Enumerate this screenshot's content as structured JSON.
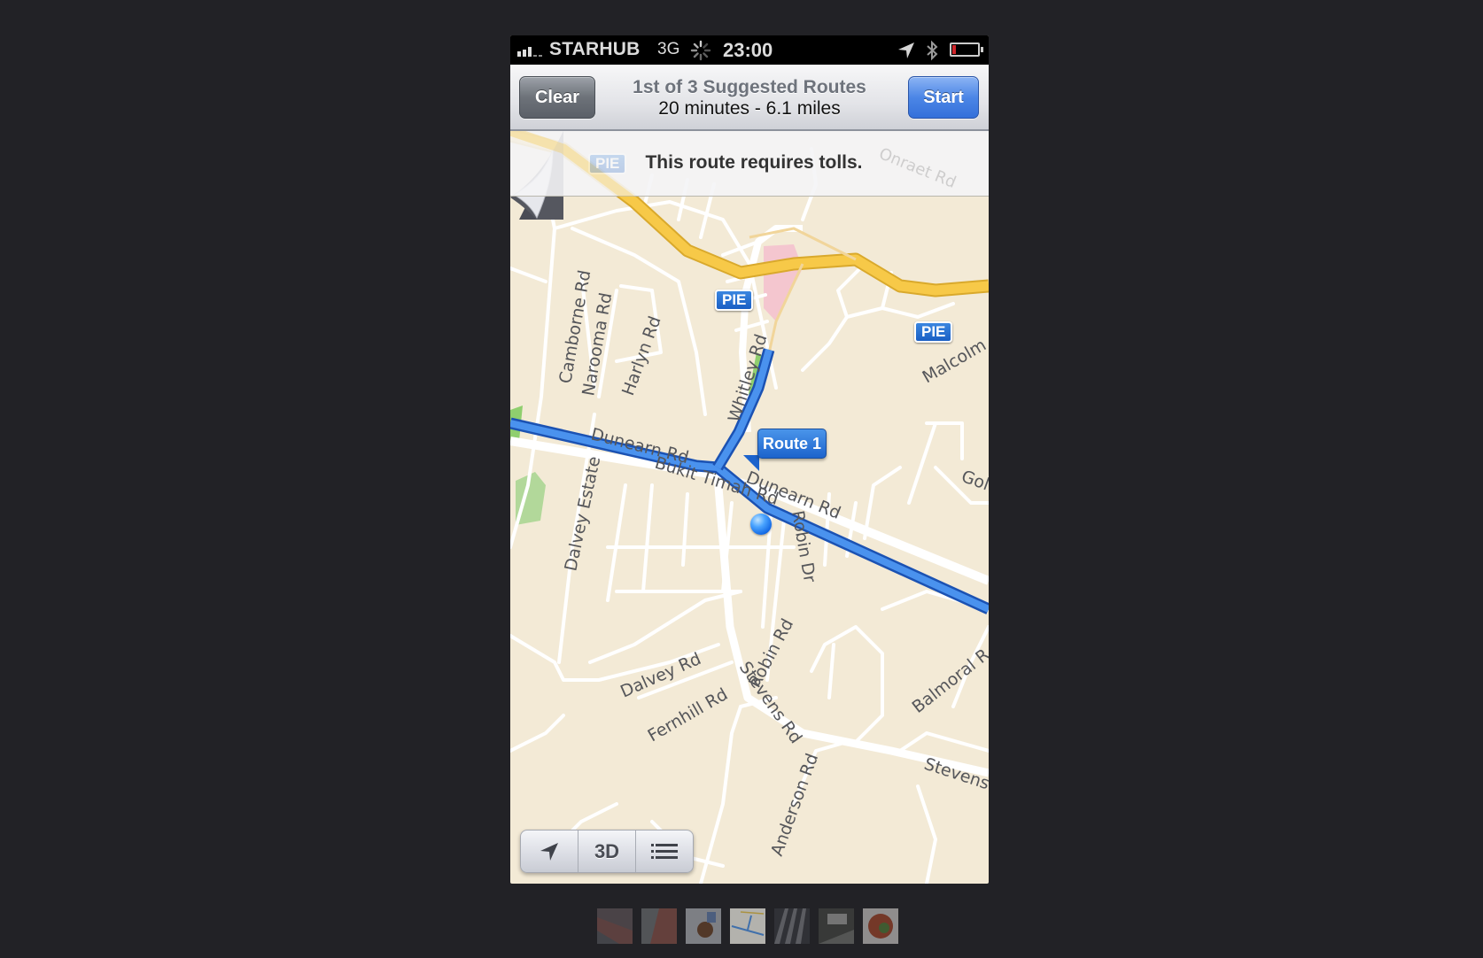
{
  "status_bar": {
    "carrier": "STARHUB",
    "network": "3G",
    "time": "23:00",
    "signal_bars": 3,
    "battery_level": 0.1,
    "icons": [
      "signal-icon",
      "activity-spinner-icon",
      "location-arrow-icon",
      "bluetooth-icon",
      "battery-icon"
    ]
  },
  "nav": {
    "clear_label": "Clear",
    "start_label": "Start",
    "title": "1st of 3 Suggested Routes",
    "subtitle": "20 minutes - 6.1 miles"
  },
  "toll_banner": {
    "message": "This route requires tolls."
  },
  "map": {
    "colors": {
      "land": "#f3ead6",
      "road": "#ffffff",
      "highway": "#f7c948",
      "route": "#2e74e0",
      "park": "#8fcf6e",
      "interchange": "#f4c6cf"
    },
    "highway_shields": [
      "PIE",
      "PIE",
      "PIE"
    ],
    "route_callout": "Route 1",
    "faded_labels": [
      "Onraet Rd"
    ],
    "road_labels": {
      "camborne": "Camborne Rd",
      "narooma": "Narooma Rd",
      "harlyn": "Harlyn Rd",
      "whitley": "Whitley Rd",
      "malcolm": "Malcolm",
      "dunearn1": "Dunearn Rd",
      "dunearn2": "Dunearn Rd",
      "bukit_timah": "Bukit Timah Rd",
      "dalvey_estate": "Dalvey Estate",
      "robin_dr": "Robin Dr",
      "gol": "Gol",
      "dalvey_rd": "Dalvey Rd",
      "fernhill": "Fernhill Rd",
      "stevens": "Stevens Rd",
      "robin_rd": "Robin Rd",
      "balmoral": "Balmoral R",
      "stevens2": "Stevens",
      "anderson": "Anderson Rd"
    }
  },
  "toolbar": {
    "locate_icon": "location-arrow-icon",
    "view_label": "3D",
    "list_icon": "list-icon"
  },
  "thumbnails": {
    "count": 7,
    "current_index": 3,
    "items": [
      "photo-thumbnail",
      "photo-thumbnail",
      "photo-thumbnail",
      "map-thumbnail",
      "photo-thumbnail",
      "photo-thumbnail",
      "photo-thumbnail"
    ]
  }
}
